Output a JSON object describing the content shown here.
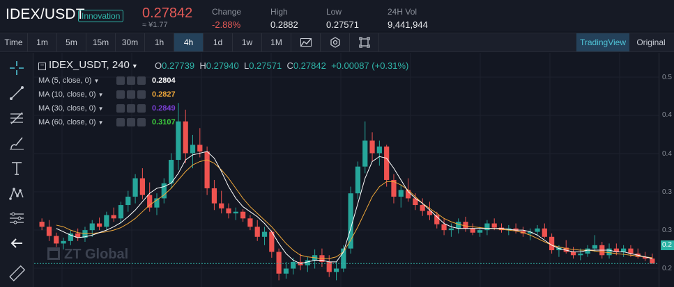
{
  "ticker": {
    "pair": "IDEX/USDT",
    "badge": "Innovation",
    "price": "0.27842",
    "cny": "≈ ¥1.77",
    "change_label": "Change",
    "change_value": "-2.88%",
    "high_label": "High",
    "high_value": "0.2882",
    "low_label": "Low",
    "low_value": "0.27571",
    "vol_label": "24H Vol",
    "vol_value": "9,441,944"
  },
  "toolbar": {
    "timeframes": [
      "Time",
      "1m",
      "5m",
      "15m",
      "30m",
      "1h",
      "4h",
      "1d",
      "1w",
      "1M"
    ],
    "active": "4h",
    "tradingview_label": "TradingView",
    "original_label": "Original"
  },
  "drawing_tools": [
    "crosshair-icon",
    "trend-line-icon",
    "fib-tool-icon",
    "brush-icon",
    "text-tool-icon",
    "pattern-icon",
    "measure-icon",
    "back-arrow-icon",
    "ruler-icon"
  ],
  "legend": {
    "symbol": "IDEX_USDT, 240",
    "o_label": "O",
    "o_value": "0.27739",
    "h_label": "H",
    "h_value": "0.27940",
    "l_label": "L",
    "l_value": "0.27571",
    "c_label": "C",
    "c_value": "0.27842",
    "change": "+0.00087 (+0.31%)",
    "ma": [
      {
        "label": "MA (5, close, 0)",
        "value": "0.2804",
        "color": "#ffffff"
      },
      {
        "label": "MA (10, close, 0)",
        "value": "0.2827",
        "color": "#f0a83a"
      },
      {
        "label": "MA (30, close, 0)",
        "value": "0.2849",
        "color": "#7b3fd6"
      },
      {
        "label": "MA (60, close, 0)",
        "value": "0.3107",
        "color": "#3ed13e"
      }
    ]
  },
  "watermark": "ZT Global",
  "axis": {
    "labels": [
      "0.5",
      "0.4",
      "0.4",
      "0.3",
      "0.3",
      "0.3",
      "0.2"
    ],
    "current": "0.2"
  },
  "colors": {
    "up": "#26a69a",
    "down": "#ef5350",
    "accent": "#2fb4a8"
  },
  "chart_data": {
    "type": "candlestick",
    "y_range": [
      0.25,
      0.53
    ],
    "ohlc": [
      [
        0.328,
        0.332,
        0.318,
        0.322
      ],
      [
        0.322,
        0.33,
        0.305,
        0.311
      ],
      [
        0.311,
        0.315,
        0.298,
        0.302
      ],
      [
        0.302,
        0.309,
        0.295,
        0.305
      ],
      [
        0.305,
        0.318,
        0.3,
        0.314
      ],
      [
        0.314,
        0.32,
        0.305,
        0.309
      ],
      [
        0.309,
        0.322,
        0.304,
        0.318
      ],
      [
        0.318,
        0.33,
        0.31,
        0.326
      ],
      [
        0.326,
        0.333,
        0.318,
        0.322
      ],
      [
        0.322,
        0.34,
        0.318,
        0.336
      ],
      [
        0.336,
        0.345,
        0.328,
        0.332
      ],
      [
        0.332,
        0.352,
        0.326,
        0.348
      ],
      [
        0.348,
        0.365,
        0.34,
        0.358
      ],
      [
        0.358,
        0.385,
        0.35,
        0.38
      ],
      [
        0.38,
        0.392,
        0.355,
        0.36
      ],
      [
        0.36,
        0.375,
        0.34,
        0.345
      ],
      [
        0.345,
        0.362,
        0.336,
        0.356
      ],
      [
        0.356,
        0.38,
        0.35,
        0.374
      ],
      [
        0.374,
        0.41,
        0.368,
        0.402
      ],
      [
        0.402,
        0.47,
        0.39,
        0.448
      ],
      [
        0.448,
        0.462,
        0.398,
        0.41
      ],
      [
        0.41,
        0.432,
        0.392,
        0.42
      ],
      [
        0.42,
        0.44,
        0.405,
        0.412
      ],
      [
        0.412,
        0.418,
        0.36,
        0.368
      ],
      [
        0.368,
        0.378,
        0.342,
        0.35
      ],
      [
        0.35,
        0.365,
        0.338,
        0.344
      ],
      [
        0.344,
        0.35,
        0.332,
        0.338
      ],
      [
        0.338,
        0.345,
        0.33,
        0.34
      ],
      [
        0.34,
        0.343,
        0.328,
        0.332
      ],
      [
        0.332,
        0.336,
        0.318,
        0.322
      ],
      [
        0.322,
        0.33,
        0.305,
        0.31
      ],
      [
        0.31,
        0.322,
        0.3,
        0.316
      ],
      [
        0.316,
        0.318,
        0.285,
        0.292
      ],
      [
        0.292,
        0.296,
        0.258,
        0.266
      ],
      [
        0.266,
        0.28,
        0.26,
        0.272
      ],
      [
        0.272,
        0.285,
        0.265,
        0.28
      ],
      [
        0.28,
        0.29,
        0.27,
        0.276
      ],
      [
        0.276,
        0.286,
        0.268,
        0.282
      ],
      [
        0.282,
        0.295,
        0.272,
        0.288
      ],
      [
        0.288,
        0.296,
        0.274,
        0.28
      ],
      [
        0.28,
        0.288,
        0.262,
        0.268
      ],
      [
        0.268,
        0.28,
        0.258,
        0.272
      ],
      [
        0.272,
        0.3,
        0.268,
        0.296
      ],
      [
        0.296,
        0.37,
        0.29,
        0.362
      ],
      [
        0.362,
        0.4,
        0.355,
        0.394
      ],
      [
        0.394,
        0.448,
        0.386,
        0.425
      ],
      [
        0.425,
        0.435,
        0.4,
        0.41
      ],
      [
        0.41,
        0.425,
        0.395,
        0.418
      ],
      [
        0.418,
        0.42,
        0.37,
        0.378
      ],
      [
        0.378,
        0.385,
        0.35,
        0.358
      ],
      [
        0.358,
        0.372,
        0.345,
        0.366
      ],
      [
        0.366,
        0.38,
        0.352,
        0.356
      ],
      [
        0.356,
        0.362,
        0.342,
        0.348
      ],
      [
        0.348,
        0.356,
        0.335,
        0.341
      ],
      [
        0.341,
        0.352,
        0.33,
        0.336
      ],
      [
        0.336,
        0.34,
        0.32,
        0.325
      ],
      [
        0.325,
        0.332,
        0.312,
        0.318
      ],
      [
        0.318,
        0.326,
        0.31,
        0.32
      ],
      [
        0.32,
        0.332,
        0.314,
        0.328
      ],
      [
        0.328,
        0.334,
        0.316,
        0.32
      ],
      [
        0.32,
        0.326,
        0.312,
        0.315
      ],
      [
        0.315,
        0.322,
        0.31,
        0.318
      ],
      [
        0.318,
        0.33,
        0.312,
        0.326
      ],
      [
        0.326,
        0.332,
        0.318,
        0.321
      ],
      [
        0.321,
        0.326,
        0.315,
        0.318
      ],
      [
        0.318,
        0.324,
        0.312,
        0.32
      ],
      [
        0.32,
        0.326,
        0.314,
        0.317
      ],
      [
        0.317,
        0.322,
        0.31,
        0.314
      ],
      [
        0.314,
        0.32,
        0.306,
        0.316
      ],
      [
        0.316,
        0.324,
        0.312,
        0.32
      ],
      [
        0.32,
        0.326,
        0.308,
        0.31
      ],
      [
        0.31,
        0.314,
        0.29,
        0.294
      ],
      [
        0.294,
        0.3,
        0.286,
        0.297
      ],
      [
        0.297,
        0.306,
        0.29,
        0.292
      ],
      [
        0.292,
        0.298,
        0.284,
        0.288
      ],
      [
        0.288,
        0.296,
        0.282,
        0.29
      ],
      [
        0.29,
        0.3,
        0.286,
        0.296
      ],
      [
        0.296,
        0.312,
        0.292,
        0.3
      ],
      [
        0.3,
        0.304,
        0.284,
        0.288
      ],
      [
        0.288,
        0.302,
        0.284,
        0.296
      ],
      [
        0.296,
        0.302,
        0.288,
        0.292
      ],
      [
        0.292,
        0.3,
        0.286,
        0.296
      ],
      [
        0.296,
        0.3,
        0.286,
        0.29
      ],
      [
        0.29,
        0.296,
        0.284,
        0.286
      ],
      [
        0.286,
        0.292,
        0.281,
        0.284
      ],
      [
        0.284,
        0.29,
        0.278,
        0.278
      ]
    ],
    "ma5": [
      0.32,
      0.316,
      0.312,
      0.309,
      0.31,
      0.312,
      0.315,
      0.318,
      0.322,
      0.327,
      0.334,
      0.342,
      0.352,
      0.362,
      0.368,
      0.37,
      0.374,
      0.386,
      0.402,
      0.408,
      0.41,
      0.412,
      0.404,
      0.388,
      0.37,
      0.356,
      0.346,
      0.34,
      0.334,
      0.326,
      0.316,
      0.302,
      0.29,
      0.282,
      0.278,
      0.28,
      0.282,
      0.282,
      0.28,
      0.28,
      0.292,
      0.32,
      0.35,
      0.38,
      0.4,
      0.406,
      0.404,
      0.392,
      0.378,
      0.364,
      0.356,
      0.35,
      0.342,
      0.334,
      0.326,
      0.322,
      0.32,
      0.32,
      0.32,
      0.32,
      0.32,
      0.32,
      0.32,
      0.319,
      0.318,
      0.318,
      0.316,
      0.312,
      0.306,
      0.3,
      0.296,
      0.294,
      0.292,
      0.292,
      0.294,
      0.294,
      0.294,
      0.294,
      0.292,
      0.292,
      0.29,
      0.288,
      0.286,
      0.284
    ],
    "ma10": [
      0.324,
      0.322,
      0.318,
      0.315,
      0.314,
      0.314,
      0.315,
      0.316,
      0.318,
      0.321,
      0.326,
      0.332,
      0.34,
      0.348,
      0.354,
      0.36,
      0.368,
      0.378,
      0.388,
      0.396,
      0.4,
      0.402,
      0.398,
      0.39,
      0.38,
      0.368,
      0.356,
      0.346,
      0.338,
      0.33,
      0.322,
      0.312,
      0.302,
      0.294,
      0.288,
      0.286,
      0.285,
      0.284,
      0.284,
      0.286,
      0.292,
      0.306,
      0.322,
      0.34,
      0.358,
      0.37,
      0.376,
      0.376,
      0.372,
      0.366,
      0.358,
      0.35,
      0.344,
      0.338,
      0.332,
      0.328,
      0.325,
      0.323,
      0.322,
      0.321,
      0.32,
      0.32,
      0.319,
      0.318,
      0.317,
      0.315,
      0.312,
      0.308,
      0.304,
      0.3,
      0.298,
      0.296,
      0.295,
      0.294,
      0.294,
      0.293,
      0.292,
      0.291,
      0.29,
      0.289,
      0.288,
      0.287,
      0.286,
      0.285
    ]
  }
}
